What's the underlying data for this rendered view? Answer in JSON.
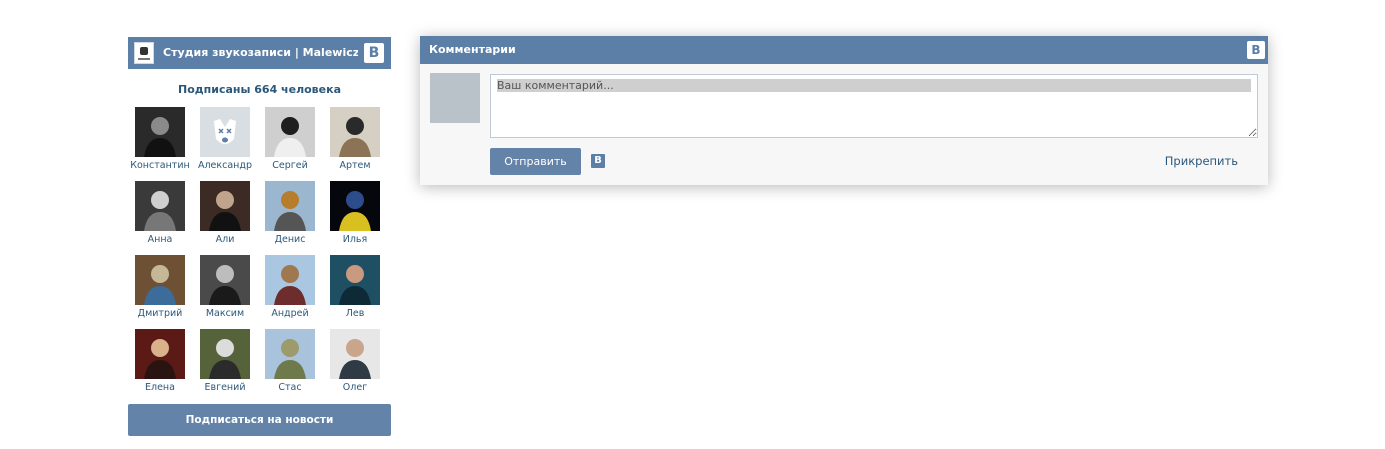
{
  "group_widget": {
    "title": "Студия звукозаписи | Malewicz...",
    "vk_logo": "В",
    "subscribers_text": "Подписаны 664 человека",
    "subscribe_button": "Подписаться на новости",
    "members": [
      {
        "name": "Константин",
        "palette": [
          "#2a2a2a",
          "#8a8a8a",
          "#111111"
        ]
      },
      {
        "name": "Александр",
        "palette": [
          "#d9dee3",
          "#ffffff",
          "#5b7fa6"
        ],
        "placeholder": true
      },
      {
        "name": "Сергей",
        "palette": [
          "#cfcfcf",
          "#1e1e1e",
          "#efefef"
        ]
      },
      {
        "name": "Артем",
        "palette": [
          "#d6d0c4",
          "#2a2a2a",
          "#8c7355"
        ]
      },
      {
        "name": "Анна",
        "palette": [
          "#3a3a3a",
          "#cfcfcf",
          "#777777"
        ]
      },
      {
        "name": "Али",
        "palette": [
          "#3b2b24",
          "#c0a58c",
          "#111111"
        ]
      },
      {
        "name": "Денис",
        "palette": [
          "#9bb7cf",
          "#b57d2c",
          "#555555"
        ]
      },
      {
        "name": "Илья",
        "palette": [
          "#06070d",
          "#2d4c8c",
          "#d9c021"
        ]
      },
      {
        "name": "Дмитрий",
        "palette": [
          "#6e5035",
          "#c7b799",
          "#3b6c9a"
        ]
      },
      {
        "name": "Максим",
        "palette": [
          "#4a4a4a",
          "#bdbdbd",
          "#1a1a1a"
        ]
      },
      {
        "name": "Андрей",
        "palette": [
          "#a9c7e1",
          "#a07850",
          "#6d2d2d"
        ]
      },
      {
        "name": "Лев",
        "palette": [
          "#1f4f63",
          "#c99a7f",
          "#0e2a36"
        ]
      },
      {
        "name": "Елена",
        "palette": [
          "#5c1a16",
          "#d9b28c",
          "#2a1411"
        ]
      },
      {
        "name": "Евгений",
        "palette": [
          "#55623a",
          "#dcdcdc",
          "#2b2b2b"
        ]
      },
      {
        "name": "Стас",
        "palette": [
          "#a9c3dd",
          "#9d9a6c",
          "#6f7a4c"
        ]
      },
      {
        "name": "Олег",
        "palette": [
          "#e7e7e7",
          "#c9a58b",
          "#2f3a44"
        ]
      }
    ]
  },
  "comments_widget": {
    "title": "Комментарии",
    "vk_logo": "В",
    "textarea_placeholder": "Ваш комментарий...",
    "send_button": "Отправить",
    "send_vk_logo": "В",
    "attach_link": "Прикрепить"
  },
  "colors": {
    "header_blue": "#5b7fa6",
    "button_blue": "#6383a8",
    "link_blue": "#2b587a"
  }
}
